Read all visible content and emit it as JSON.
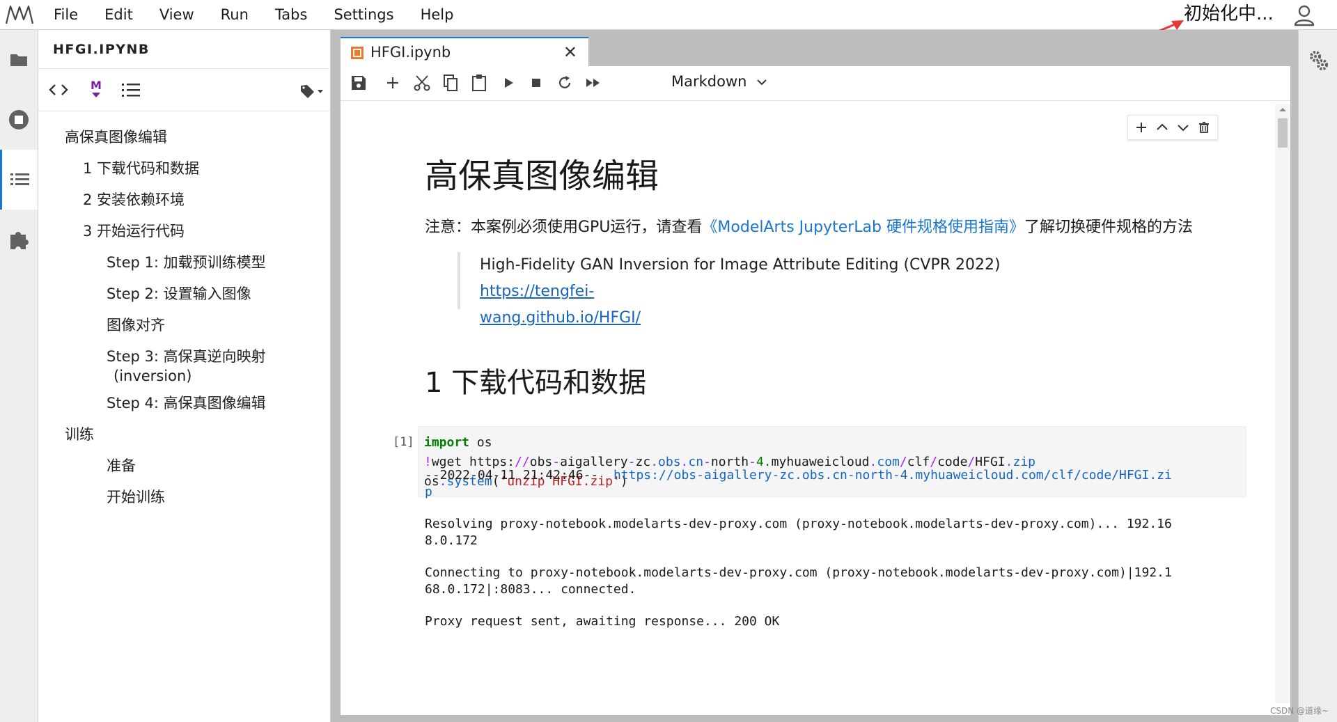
{
  "menubar": {
    "items": [
      "File",
      "Edit",
      "View",
      "Run",
      "Tabs",
      "Settings",
      "Help"
    ],
    "kernel_status": "初始化中..."
  },
  "sidebar": {
    "icons": [
      "folder-icon",
      "running-icon",
      "toc-icon",
      "extension-icon"
    ],
    "active": "toc-icon"
  },
  "toc": {
    "title": "HFGI.IPYNB",
    "items": [
      "高保真图像编辑",
      "1 下载代码和数据",
      "2 安装依赖环境",
      "3 开始运行代码",
      "Step 1: 加载预训练模型",
      "Step 2: 设置输入图像",
      "图像对齐",
      "Step 3: 高保真逆向映射",
      "(inversion)",
      "Step 4: 高保真图像编辑",
      "训练",
      "准备",
      "开始训练"
    ]
  },
  "tab": {
    "label": "HFGI.ipynb",
    "close": "✕"
  },
  "toolbar": {
    "cell_type": "Markdown"
  },
  "notebook": {
    "h1": "高保真图像编辑",
    "note_prefix": "注意：本案例必须使用GPU运行，请查看",
    "note_link": "《ModelArts JupyterLab 硬件规格使用指南》",
    "note_suffix": "了解切换硬件规格的方法",
    "quote_text": "High-Fidelity GAN Inversion for Image Attribute Editing (CVPR 2022) ",
    "quote_link_1": "https://tengfei-",
    "quote_link_2": "wang.github.io/HFGI/",
    "h2": "1 下载代码和数据",
    "prompt": "[1]",
    "output": {
      "line1_prefix": "--2022-04-11 21:42:46--  ",
      "line1_link": "https://obs-aigallery-zc.obs.cn-north-4.myhuaweicloud.com/clf/code/HFGI.zi",
      "line2_link": "p",
      "line3": "Resolving proxy-notebook.modelarts-dev-proxy.com (proxy-notebook.modelarts-dev-proxy.com)... 192.16",
      "line4": "8.0.172",
      "line5": "Connecting to proxy-notebook.modelarts-dev-proxy.com (proxy-notebook.modelarts-dev-proxy.com)|192.1",
      "line6": "68.0.172|:8083... connected.",
      "line7": "Proxy request sent, awaiting response... 200 OK"
    }
  },
  "watermark": "CSDN @道缘~",
  "colors": {
    "accent": "#1976d2",
    "link": "#1565c0",
    "arrow": "#e53935"
  }
}
